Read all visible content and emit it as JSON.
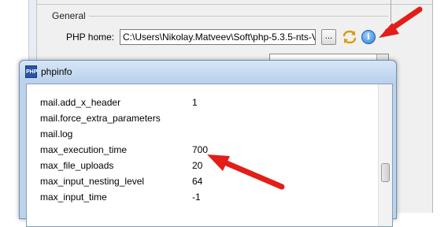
{
  "settings": {
    "section_label": "General",
    "php_home_label": "PHP home:",
    "php_home_value": "C:\\Users\\Nikolay.Matveev\\Soft\\php-5.3.5-nts-V",
    "browse_label": "...",
    "icons": {
      "sync": "sync-icon",
      "info": "info-icon"
    }
  },
  "phpinfo": {
    "title": "phpinfo",
    "rows": [
      {
        "name": "mail.add_x_header",
        "value": "1"
      },
      {
        "name": "mail.force_extra_parameters",
        "value": ""
      },
      {
        "name": "mail.log",
        "value": ""
      },
      {
        "name": "max_execution_time",
        "value": "700"
      },
      {
        "name": "max_file_uploads",
        "value": "20"
      },
      {
        "name": "max_input_nesting_level",
        "value": "64"
      },
      {
        "name": "max_input_time",
        "value": "-1"
      }
    ]
  },
  "colors": {
    "arrow": "#e31d18"
  }
}
